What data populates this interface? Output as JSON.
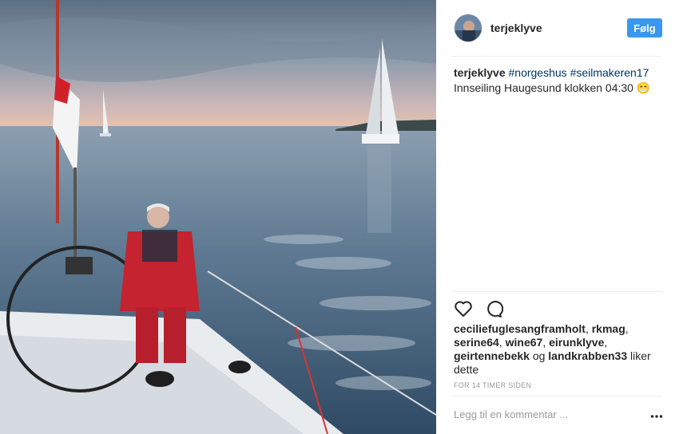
{
  "post": {
    "photo_subject": "sailboat-photo",
    "username": "terjeklyve",
    "follow_label": "Følg",
    "caption": {
      "user": "terjeklyve",
      "hashtags": [
        "#norgeshus",
        "#seilmakeren17"
      ],
      "text": "Innseiling Haugesund klokken 04:30",
      "emoji": "😁"
    },
    "likes": {
      "names": [
        "ceciliefuglesangframholt",
        "rkmag",
        "serine64",
        "wine67",
        "eirunklyve",
        "geirtennebekk",
        "landkrabben33"
      ],
      "connector": "og",
      "suffix": "liker dette"
    },
    "timestamp": "FOR 14 TIMER SIDEN",
    "comment_placeholder": "Legg til en kommentar ..."
  },
  "icons": {
    "like": "heart-icon",
    "comment": "comment-icon",
    "more": "more-options-icon"
  },
  "colors": {
    "follow_button": "#3897f0",
    "hashtag": "#003569",
    "text": "#262626",
    "muted": "#999999"
  }
}
